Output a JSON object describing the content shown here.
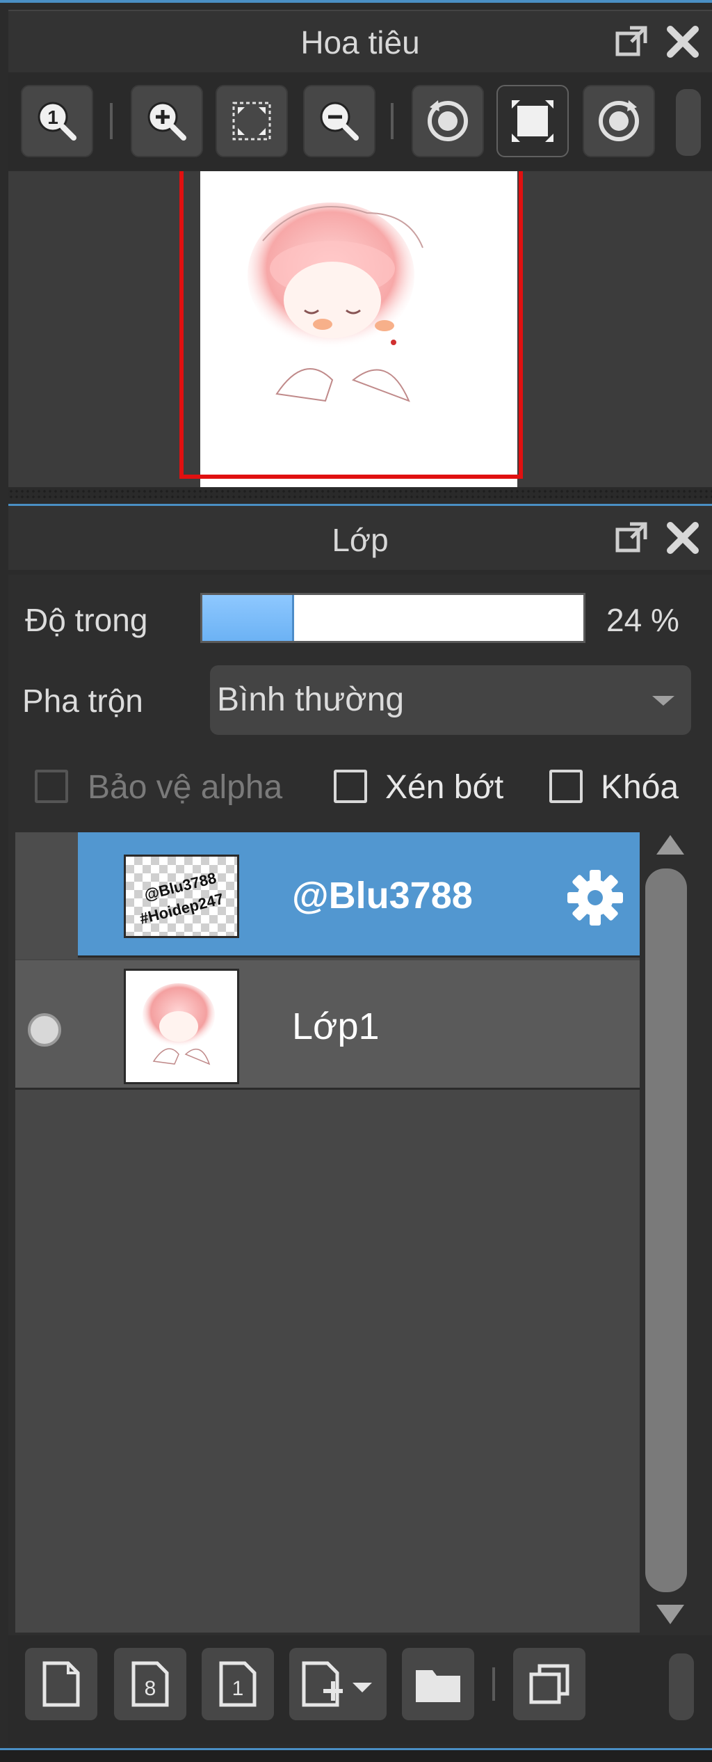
{
  "navigator": {
    "title": "Hoa tiêu",
    "toolbar": [
      {
        "icon": "zoom-actual-size-icon"
      },
      {
        "icon": "zoom-in-icon"
      },
      {
        "icon": "fit-to-window-icon"
      },
      {
        "icon": "zoom-out-icon"
      },
      {
        "icon": "rotate-left-icon"
      },
      {
        "icon": "fit-canvas-icon"
      },
      {
        "icon": "rotate-right-icon"
      }
    ],
    "header_icons": [
      "popout-icon",
      "close-icon"
    ]
  },
  "layers": {
    "title": "Lớp",
    "opacity_label": "Độ trong",
    "opacity_value": 24,
    "opacity_text": "24 %",
    "blend_label": "Pha trộn",
    "blend_value": "Bình thường",
    "protect_alpha_label": "Bảo vệ alpha",
    "clip_label": "Xén bớt",
    "lock_label": "Khóa",
    "list": [
      {
        "name": "@Blu3788",
        "selected": true,
        "thumb_text": "@Blu3788 #Hoidep247",
        "visible": false
      },
      {
        "name": "Lớp1",
        "selected": false,
        "visible": true
      }
    ],
    "bottom_icons": [
      "new-layer-icon",
      "new-8bit-layer-icon",
      "new-1bit-layer-icon",
      "add-layer-dropdown-icon",
      "folder-icon",
      "duplicate-layer-icon"
    ]
  },
  "colors": {
    "accent": "#4a8fc4",
    "selected_row": "#5297d0",
    "nav_frame": "#e01010"
  }
}
